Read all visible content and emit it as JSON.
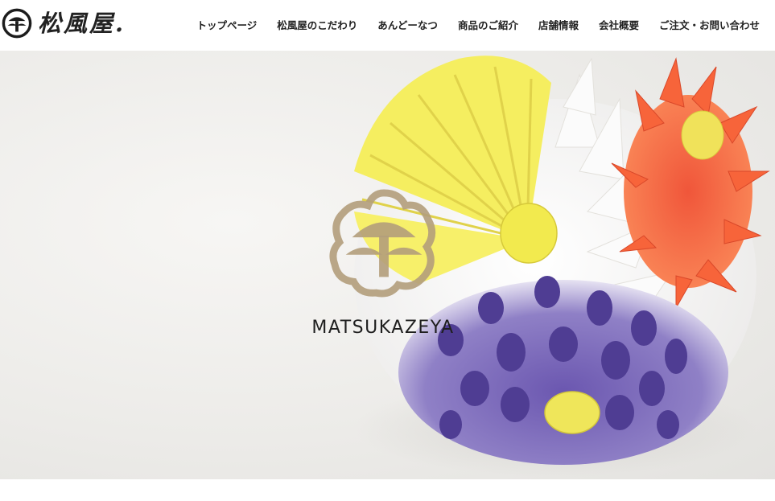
{
  "header": {
    "logo_text": "松風屋.",
    "logo_icon": "matsukazeya-crest-icon"
  },
  "nav": {
    "items": [
      {
        "label": "トップページ"
      },
      {
        "label": "松風屋のこだわり"
      },
      {
        "label": "あんどーなつ"
      },
      {
        "label": "商品のご紹介"
      },
      {
        "label": "店舗情報"
      },
      {
        "label": "会社概要"
      },
      {
        "label": "ご注文・お問い合わせ"
      }
    ]
  },
  "hero": {
    "brand_name": "MATSUKAZEYA",
    "image_subject": "wagashi-chrysanthemum-sweet",
    "colors": {
      "yellow": "#f3ec5a",
      "orange": "#f26a3c",
      "purple": "#5e4aa3",
      "crest": "#b09a78",
      "background": "#ecebe8"
    }
  }
}
